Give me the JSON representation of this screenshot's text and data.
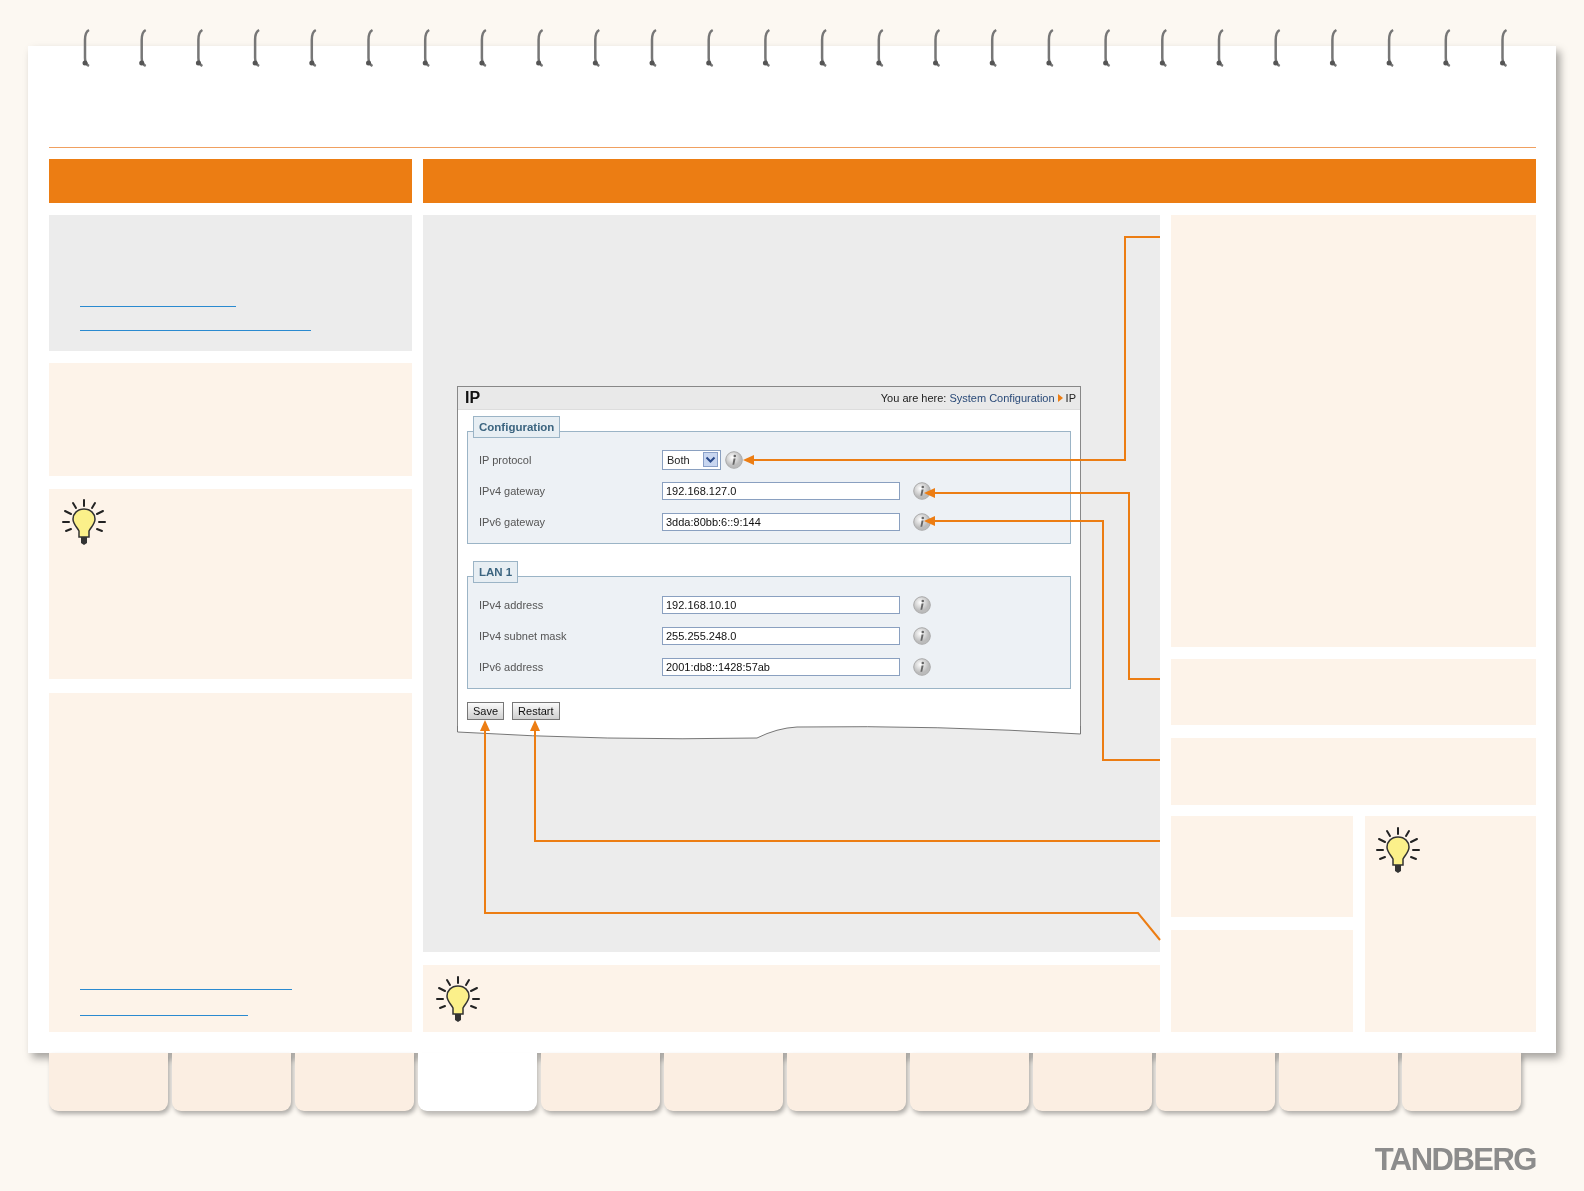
{
  "screen": {
    "title": "IP",
    "breadcrumb": {
      "prefix": "You are here:",
      "path": [
        {
          "label": "System Configuration",
          "link": true
        },
        {
          "label": "IP",
          "link": false
        }
      ]
    },
    "sections": [
      {
        "legend": "Configuration",
        "fields": [
          {
            "kind": "select",
            "label": "IP protocol",
            "value": "Both"
          },
          {
            "kind": "text",
            "label": "IPv4 gateway",
            "value": "192.168.127.0"
          },
          {
            "kind": "text",
            "label": "IPv6 gateway",
            "value": "3dda:80bb:6::9:144"
          }
        ]
      },
      {
        "legend": "LAN 1",
        "fields": [
          {
            "kind": "text",
            "label": "IPv4 address",
            "value": "192.168.10.10"
          },
          {
            "kind": "text",
            "label": "IPv4 subnet mask",
            "value": "255.255.248.0"
          },
          {
            "kind": "text",
            "label": "IPv6 address",
            "value": "2001:db8::1428:57ab"
          }
        ]
      }
    ],
    "buttons": [
      "Save",
      "Restart"
    ]
  },
  "tabs": [
    {
      "selected": false
    },
    {
      "selected": false
    },
    {
      "selected": false
    },
    {
      "selected": true
    },
    {
      "selected": false
    },
    {
      "selected": false
    },
    {
      "selected": false
    },
    {
      "selected": false
    },
    {
      "selected": false
    },
    {
      "selected": false
    },
    {
      "selected": false
    },
    {
      "selected": false
    }
  ],
  "logo": "TANDBERG"
}
